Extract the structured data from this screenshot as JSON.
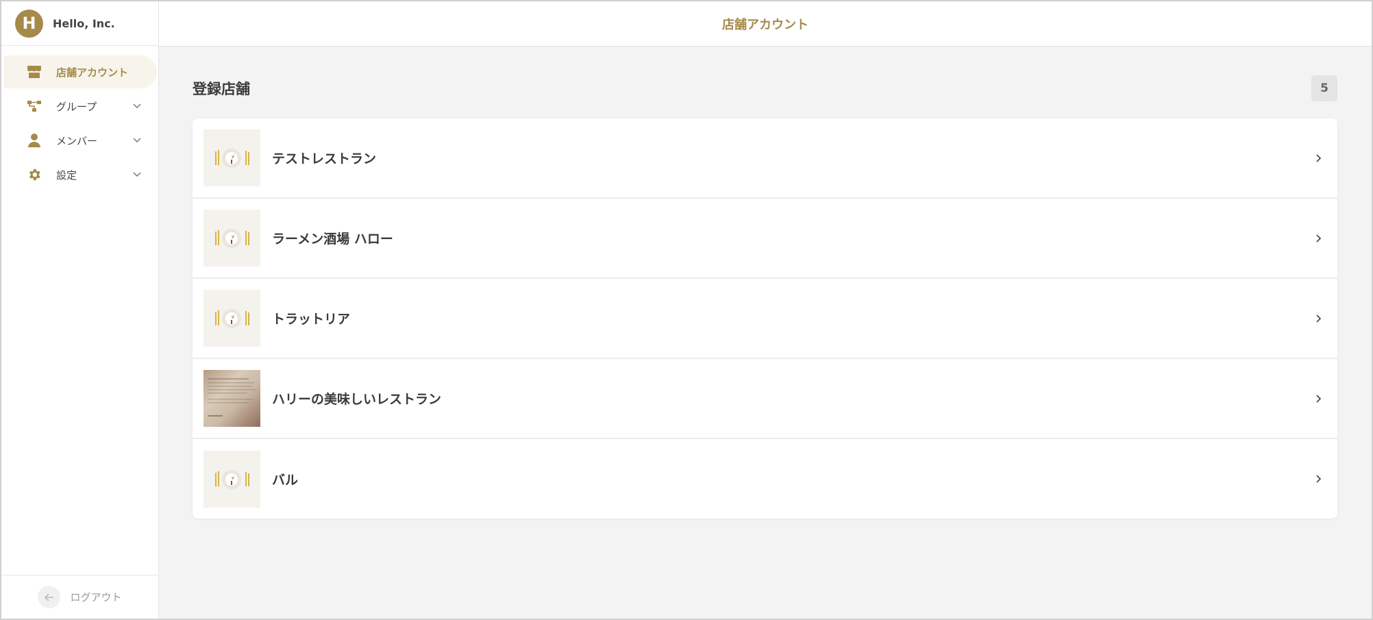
{
  "brand": {
    "initial": "H",
    "name": "Hello, Inc."
  },
  "topbar": {
    "title": "店舗アカウント"
  },
  "sidebar": {
    "items": [
      {
        "label": "店舗アカウント",
        "icon": "store-icon",
        "active": true,
        "expandable": false
      },
      {
        "label": "グループ",
        "icon": "hierarchy-icon",
        "active": false,
        "expandable": true
      },
      {
        "label": "メンバー",
        "icon": "person-icon",
        "active": false,
        "expandable": true
      },
      {
        "label": "設定",
        "icon": "gear-icon",
        "active": false,
        "expandable": true
      }
    ],
    "logout_label": "ログアウト"
  },
  "section": {
    "title": "登録店舗",
    "count": "5"
  },
  "stores": [
    {
      "name": "テストレストラン",
      "thumbnail": "plate-illustration"
    },
    {
      "name": "ラーメン酒場 ハロー",
      "thumbnail": "plate-illustration"
    },
    {
      "name": "トラットリア",
      "thumbnail": "plate-illustration"
    },
    {
      "name": "ハリーの美味しいレストラン",
      "thumbnail": "photo"
    },
    {
      "name": "バル",
      "thumbnail": "plate-illustration"
    }
  ],
  "colors": {
    "accent": "#a68a4a",
    "background": "#f3f3f3",
    "active_bg": "#f7f4ec"
  }
}
